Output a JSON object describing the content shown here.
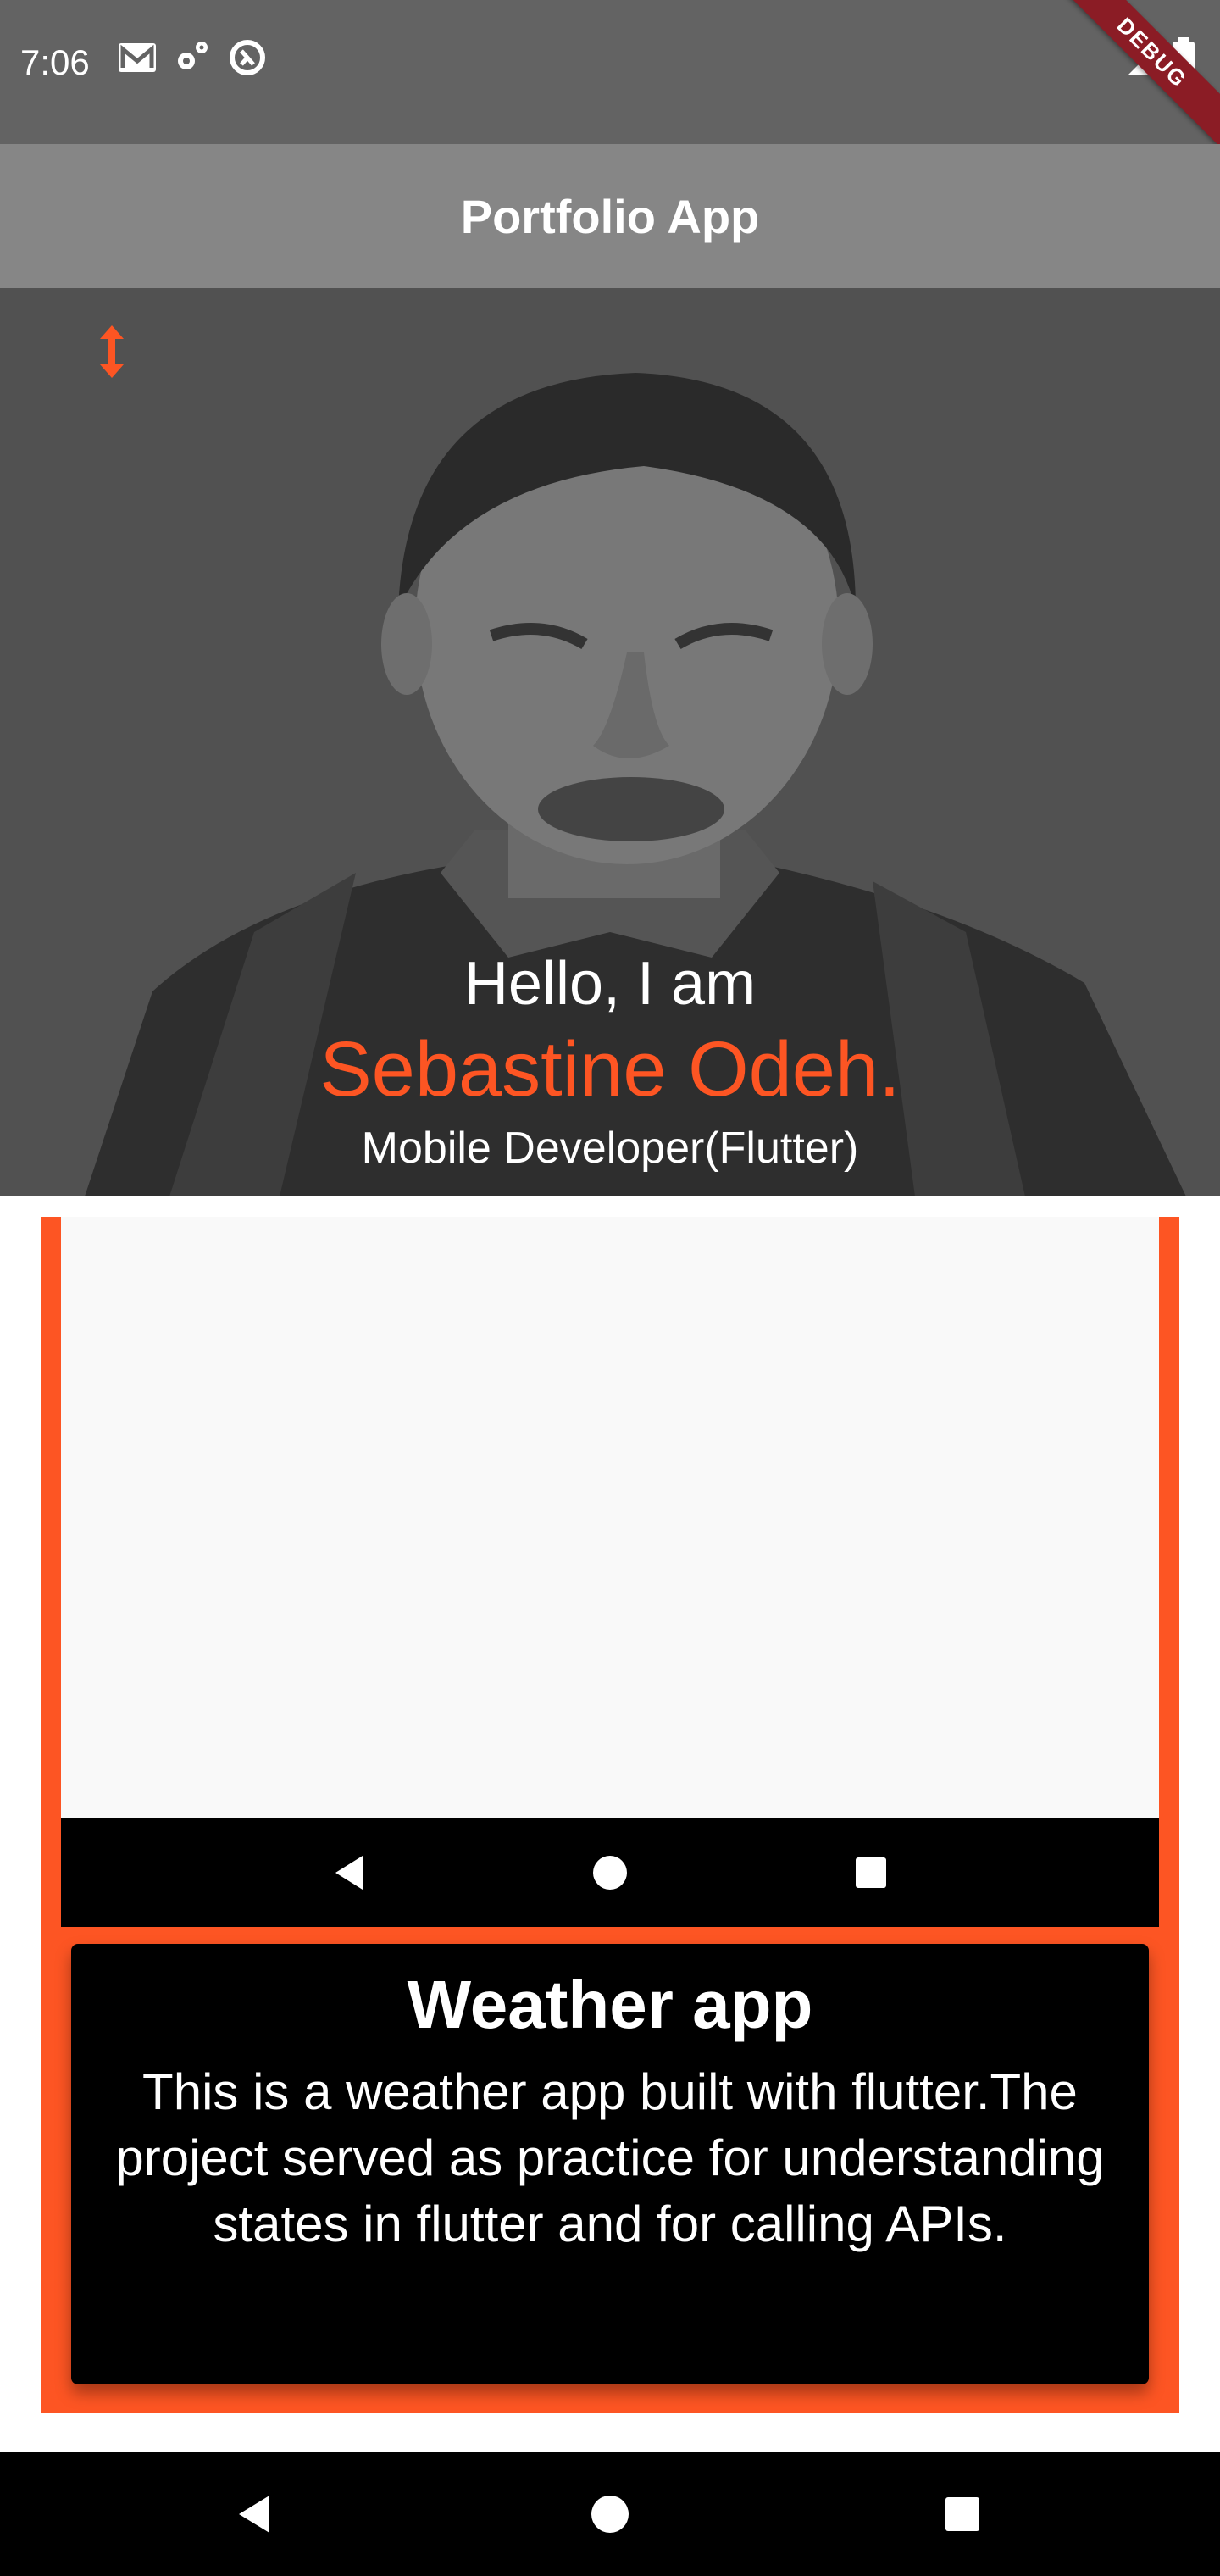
{
  "status_bar": {
    "time": "7:06",
    "icons": [
      "gmail-icon",
      "settings-icon",
      "data-saver-icon",
      "signal-icon",
      "battery-icon"
    ],
    "debug_banner": "DEBUG"
  },
  "app_bar": {
    "title": "Portfolio App"
  },
  "hero": {
    "greeting": "Hello, I am",
    "name": "Sebastine Odeh.",
    "role": "Mobile Developer(Flutter)",
    "toggle_icon": "swap-vert-icon"
  },
  "project": {
    "title": "Weather app",
    "description": "This is a weather app built with flutter.The project served as practice for understanding states in flutter and for calling APIs.",
    "preview_nav_icons": [
      "back-icon",
      "home-icon",
      "recents-icon"
    ]
  },
  "system_nav": {
    "icons": [
      "back-icon",
      "home-icon",
      "recents-icon"
    ]
  },
  "colors": {
    "accent": "#fd5523",
    "status_bar": "#636363",
    "app_bar": "#868686",
    "hero_bg": "#515151"
  }
}
